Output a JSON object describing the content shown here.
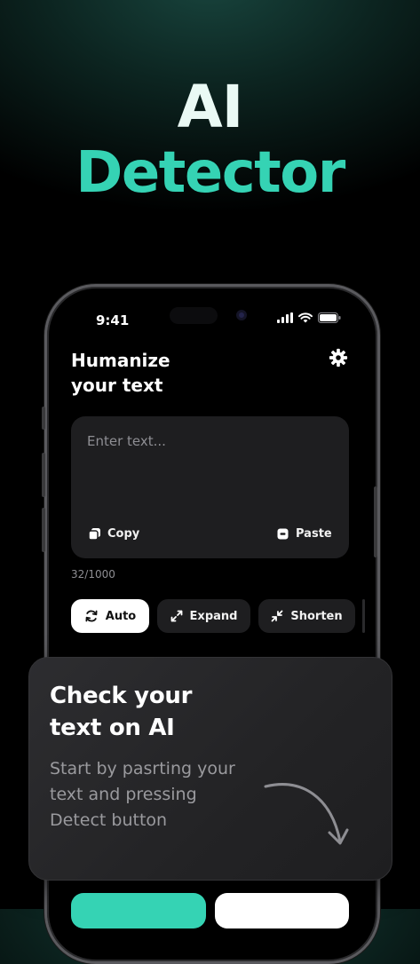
{
  "hero": {
    "line1": "AI",
    "line2": "Detector"
  },
  "status_bar": {
    "time": "9:41"
  },
  "screen": {
    "title_line1": "Humanize",
    "title_line2": "your text",
    "text_input": {
      "placeholder": "Enter text...",
      "value": ""
    },
    "copy_label": "Copy",
    "paste_label": "Paste",
    "char_counter": "32/1000",
    "modes": [
      {
        "label": "Auto",
        "icon": "refresh-icon",
        "selected": true
      },
      {
        "label": "Expand",
        "icon": "expand-icon",
        "selected": false
      },
      {
        "label": "Shorten",
        "icon": "shrink-icon",
        "selected": false
      }
    ]
  },
  "overlay": {
    "title_line1": "Check your",
    "title_line2": "text on AI",
    "desc_line1": "Start by pasrting your",
    "desc_line2": "text and pressing",
    "desc_line3": "Detect button"
  },
  "colors": {
    "accent": "#35d3b4",
    "background": "#000000",
    "card": "#1e1e20",
    "hero_title": "#eafaf5"
  }
}
